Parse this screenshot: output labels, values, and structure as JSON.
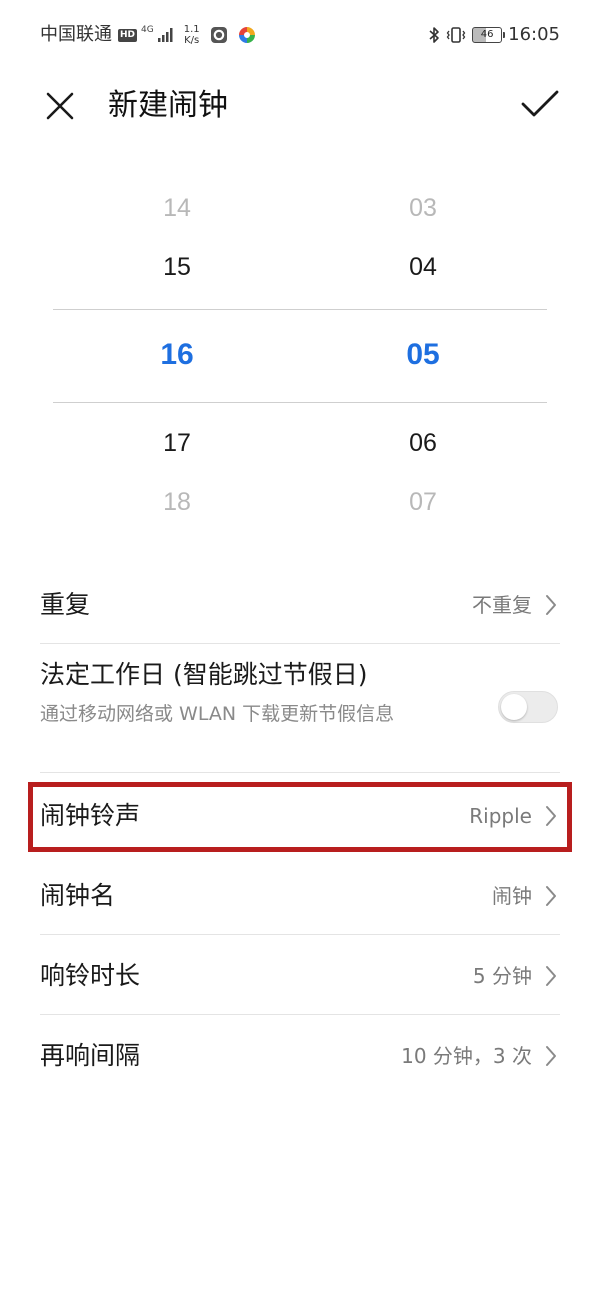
{
  "status_bar": {
    "carrier": "中国联通",
    "hd_badge": "HD",
    "network": "4G",
    "speed_value": "1.1",
    "speed_unit": "K/s",
    "battery_level": "46",
    "time": "16:05"
  },
  "header": {
    "title": "新建闹钟",
    "close_icon": "close-icon",
    "confirm_icon": "check-icon"
  },
  "picker": {
    "hours": [
      "14",
      "15",
      "16",
      "17",
      "18"
    ],
    "minutes": [
      "03",
      "04",
      "05",
      "06",
      "07"
    ],
    "selected_color": "#1e6fe0"
  },
  "settings": {
    "repeat": {
      "label": "重复",
      "value": "不重复"
    },
    "workday": {
      "label": "法定工作日 (智能跳过节假日)",
      "description": "通过移动网络或 WLAN 下载更新节假信息",
      "enabled": false
    },
    "ringtone": {
      "label": "闹钟铃声",
      "value": "Ripple"
    },
    "alarm_name": {
      "label": "闹钟名",
      "value": "闹钟"
    },
    "ring_duration": {
      "label": "响铃时长",
      "value": "5 分钟"
    },
    "snooze": {
      "label": "再响间隔",
      "value": "10 分钟，3 次"
    }
  },
  "highlight_color": "#b81e1e"
}
